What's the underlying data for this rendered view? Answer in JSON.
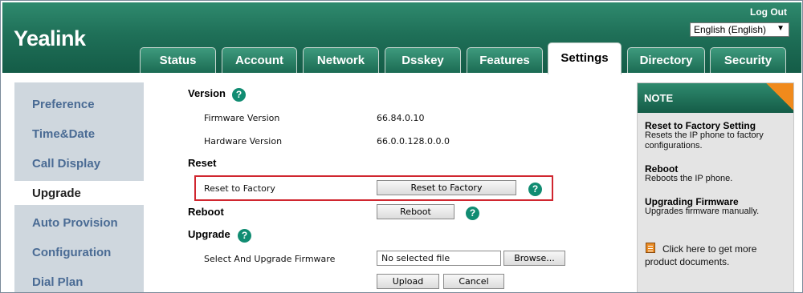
{
  "header": {
    "logo": "Yealink",
    "logout": "Log Out",
    "language": "English (English)"
  },
  "tabs": [
    {
      "label": "Status"
    },
    {
      "label": "Account"
    },
    {
      "label": "Network"
    },
    {
      "label": "Dsskey"
    },
    {
      "label": "Features"
    },
    {
      "label": "Settings",
      "active": true
    },
    {
      "label": "Directory"
    },
    {
      "label": "Security"
    }
  ],
  "sidebar": {
    "items": [
      {
        "label": "Preference"
      },
      {
        "label": "Time&Date"
      },
      {
        "label": "Call Display"
      },
      {
        "label": "Upgrade",
        "active": true
      },
      {
        "label": "Auto Provision"
      },
      {
        "label": "Configuration"
      },
      {
        "label": "Dial Plan"
      }
    ]
  },
  "main": {
    "version_title": "Version",
    "firmware_label": "Firmware Version",
    "firmware_value": "66.84.0.10",
    "hardware_label": "Hardware Version",
    "hardware_value": "66.0.0.128.0.0.0",
    "reset_title": "Reset",
    "reset_label": "Reset to Factory",
    "reset_button": "Reset to Factory",
    "reboot_label": "Reboot",
    "reboot_button": "Reboot",
    "upgrade_title": "Upgrade",
    "upgrade_label": "Select And Upgrade Firmware",
    "file_value": "No selected file",
    "browse_button": "Browse...",
    "upload_button": "Upload",
    "cancel_button": "Cancel",
    "help_glyph": "?"
  },
  "note": {
    "title": "NOTE",
    "entries": [
      {
        "title": "Reset to Factory Setting",
        "text": "Resets the IP phone to factory configurations."
      },
      {
        "title": "Reboot",
        "text": "Reboots the IP phone."
      },
      {
        "title": "Upgrading Firmware",
        "text": "Upgrades firmware manually."
      }
    ],
    "doc_link": "Click here to get more product documents."
  },
  "colors": {
    "header_green": "#1f7058",
    "nav_link": "#4a6b94",
    "help_icon": "#118c72",
    "highlight": "#d0262f",
    "note_corner": "#f08a1c"
  }
}
